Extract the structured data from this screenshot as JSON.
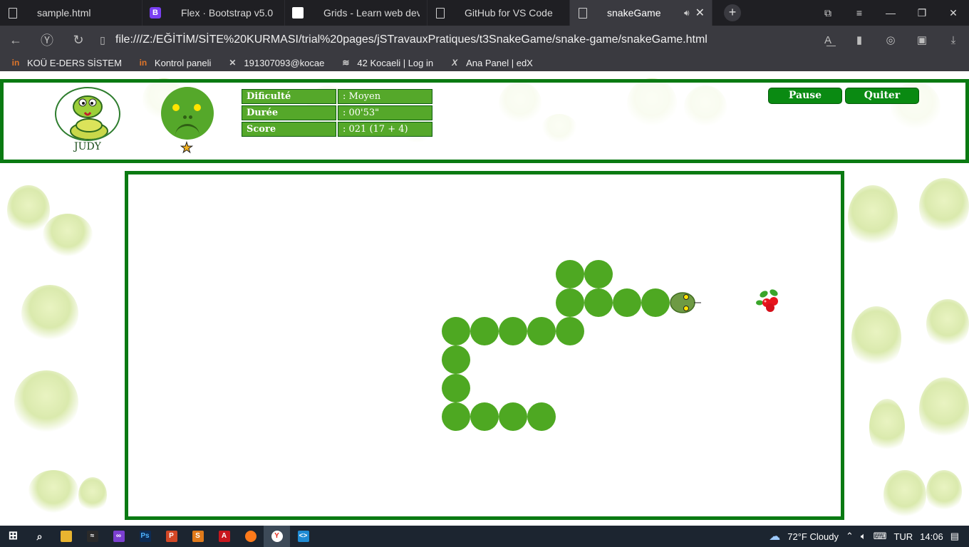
{
  "browser": {
    "tabs": [
      {
        "title": "sample.html",
        "icon": "document-icon"
      },
      {
        "title": "Flex · Bootstrap v5.0",
        "icon": "bootstrap-icon"
      },
      {
        "title": "Grids - Learn web developr",
        "icon": "mdn-icon"
      },
      {
        "title": "GitHub for VS Code",
        "icon": "document-icon"
      },
      {
        "title": "snakeGame",
        "icon": "document-icon",
        "active": true,
        "audio": "speaker-icon"
      }
    ],
    "new_tab": "+",
    "window_controls": {
      "minimize": "—",
      "restore": "❐",
      "close": "✕"
    },
    "url": "file:///Z:/EĞİTİM/SİTE%20KURMASI/trial%20pages/jSTravauxPratiques/t3SnakeGame/snake-game/snakeGame.html",
    "bookmarks": [
      {
        "label": "KOÜ E-DERS SİSTEM",
        "icon": "kou-icon"
      },
      {
        "label": "Kontrol paneli",
        "icon": "kou-icon"
      },
      {
        "label": "191307093@kocae",
        "icon": "mail-icon"
      },
      {
        "label": "42 Kocaeli | Log in",
        "icon": "42-icon"
      },
      {
        "label": "Ana Panel | edX",
        "icon": "edx-icon"
      }
    ]
  },
  "game": {
    "player_name": "JUDY",
    "stats": [
      {
        "label": "Dificulté",
        "value": ": Moyen"
      },
      {
        "label": "Durée",
        "value": ": 00'53\""
      },
      {
        "label": "Score",
        "value": ": 021 (17 + 4)"
      }
    ],
    "buttons": {
      "pause": "Pause",
      "quit": "Quiter"
    },
    "board": {
      "cols": 25,
      "rows": 12,
      "snake_color": "#4ea822",
      "head_color": "#6e9a44",
      "body": [
        [
          15,
          3
        ],
        [
          16,
          3
        ],
        [
          15,
          4
        ],
        [
          16,
          4
        ],
        [
          17,
          4
        ],
        [
          18,
          4
        ],
        [
          15,
          5
        ],
        [
          14,
          5
        ],
        [
          13,
          5
        ],
        [
          12,
          5
        ],
        [
          11,
          5
        ],
        [
          11,
          6
        ],
        [
          11,
          7
        ],
        [
          11,
          8
        ],
        [
          12,
          8
        ],
        [
          13,
          8
        ],
        [
          14,
          8
        ]
      ],
      "head": [
        19,
        4
      ],
      "food": [
        22,
        4
      ]
    }
  },
  "taskbar": {
    "weather": "72°F  Cloudy",
    "language": "TUR",
    "time": "14:06"
  },
  "colors": {
    "frame": "#0a7a12",
    "cell": "#55a82a",
    "chrome": "#3a3a40"
  }
}
